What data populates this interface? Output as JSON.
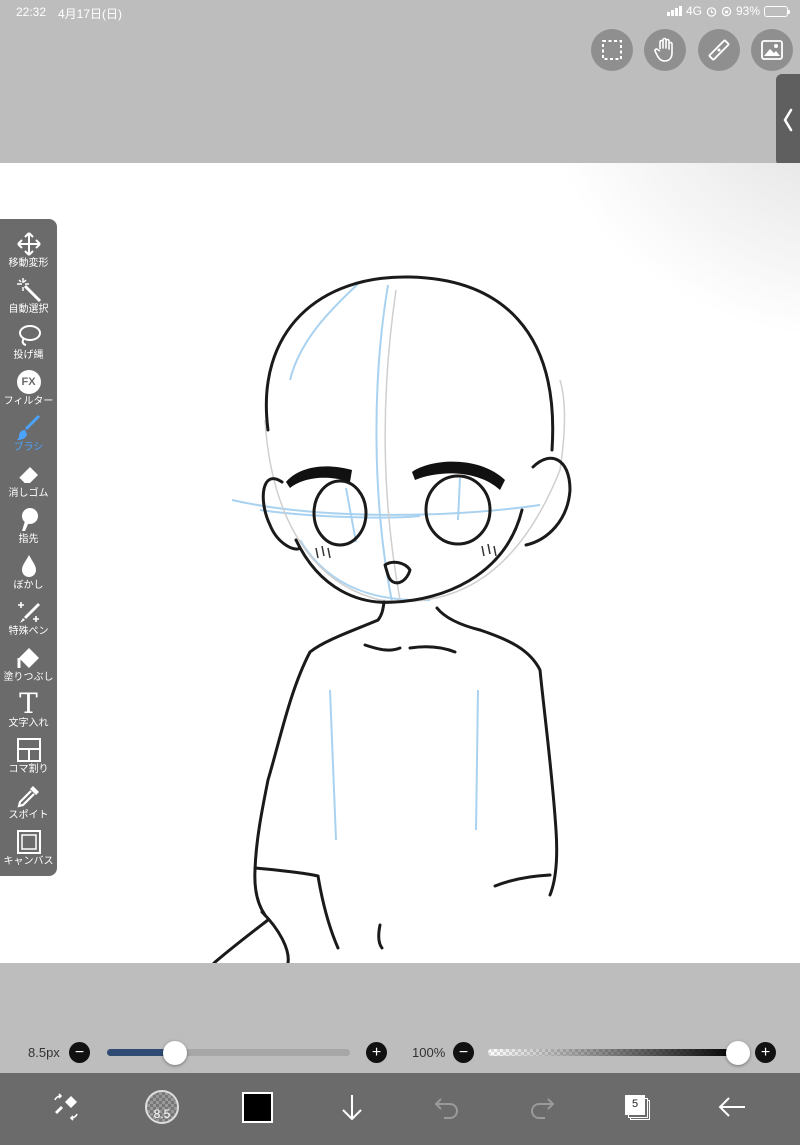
{
  "status_bar": {
    "time": "22:32",
    "date": "4月17日(日)",
    "network": "4G",
    "battery": "93%"
  },
  "top_buttons": [
    {
      "name": "selection-icon"
    },
    {
      "name": "hand-icon"
    },
    {
      "name": "ruler-icon"
    },
    {
      "name": "image-icon"
    }
  ],
  "tools": [
    {
      "name": "move-transform",
      "label": "移動変形",
      "icon": "move-icon"
    },
    {
      "name": "auto-select",
      "label": "自動選択",
      "icon": "magic-wand-icon"
    },
    {
      "name": "lasso",
      "label": "投げ縄",
      "icon": "lasso-icon"
    },
    {
      "name": "filter",
      "label": "フィルター",
      "icon": "fx-icon",
      "icon_text": "FX"
    },
    {
      "name": "brush",
      "label": "ブラシ",
      "icon": "brush-icon",
      "active": true
    },
    {
      "name": "eraser",
      "label": "消しゴム",
      "icon": "eraser-icon"
    },
    {
      "name": "finger",
      "label": "指先",
      "icon": "finger-icon"
    },
    {
      "name": "blur",
      "label": "ぼかし",
      "icon": "drop-icon"
    },
    {
      "name": "special-pen",
      "label": "特殊ペン",
      "icon": "sparkle-pen-icon"
    },
    {
      "name": "fill",
      "label": "塗りつぶし",
      "icon": "bucket-icon"
    },
    {
      "name": "text",
      "label": "文字入れ",
      "icon": "text-icon",
      "icon_text": "T"
    },
    {
      "name": "frame-divider",
      "label": "コマ割り",
      "icon": "frame-icon"
    },
    {
      "name": "eyedropper",
      "label": "スポイト",
      "icon": "eyedropper-icon"
    },
    {
      "name": "canvas",
      "label": "キャンバス",
      "icon": "canvas-icon"
    }
  ],
  "brush_size": {
    "label": "8.5px",
    "value": 8.5,
    "fraction": 0.28
  },
  "opacity": {
    "label": "100%",
    "value": 100,
    "fraction": 1.0
  },
  "bottom_bar": {
    "brush_preview_label": "8.5",
    "color": "#000000",
    "layer_count": "5"
  },
  "accent_color": "#4aa3ff"
}
